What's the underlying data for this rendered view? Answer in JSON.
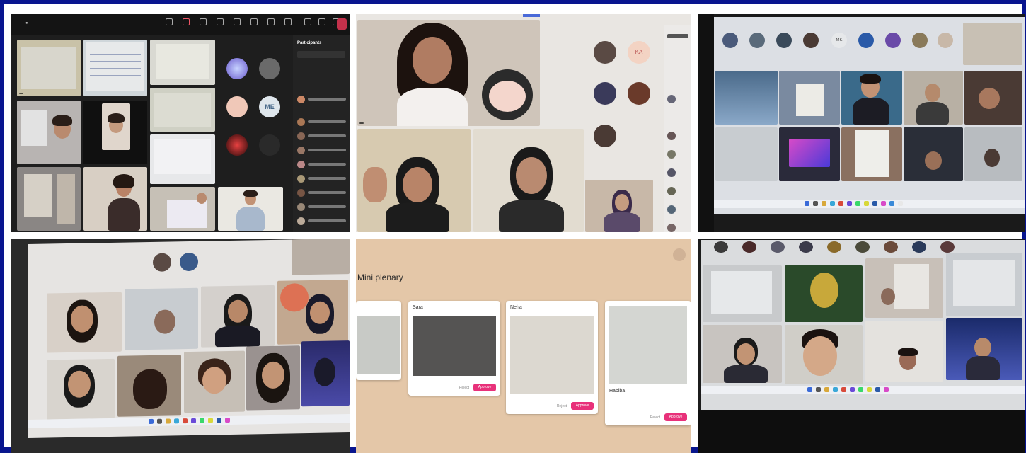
{
  "collage": {
    "panels": [
      {
        "id": "teams-grid",
        "label": "Teams meeting grid"
      },
      {
        "id": "light-meeting",
        "label": "Meeting with participants"
      },
      {
        "id": "laptop-gallery-1",
        "label": "Laptop gallery view"
      },
      {
        "id": "laptop-gallery-2",
        "label": "Laptop gallery view"
      },
      {
        "id": "mini-plenary",
        "label": "Mini plenary board"
      },
      {
        "id": "laptop-gallery-3",
        "label": "Laptop gallery view"
      }
    ]
  },
  "teams": {
    "participants_title": "Participants"
  },
  "plenary": {
    "title": "Mini plenary",
    "cards": [
      {
        "name": "Sara",
        "reject": "Reject",
        "approve": "Approve"
      },
      {
        "name": "Neha",
        "reject": "Reject",
        "approve": "Approve"
      },
      {
        "name": "Habiba",
        "reject": "Reject",
        "approve": "Approve"
      }
    ]
  },
  "colors": {
    "border": "#08158f",
    "approve": "#e8317a",
    "teams_dark": "#1e1e1e",
    "plenary_bg": "#e4c7a8"
  }
}
